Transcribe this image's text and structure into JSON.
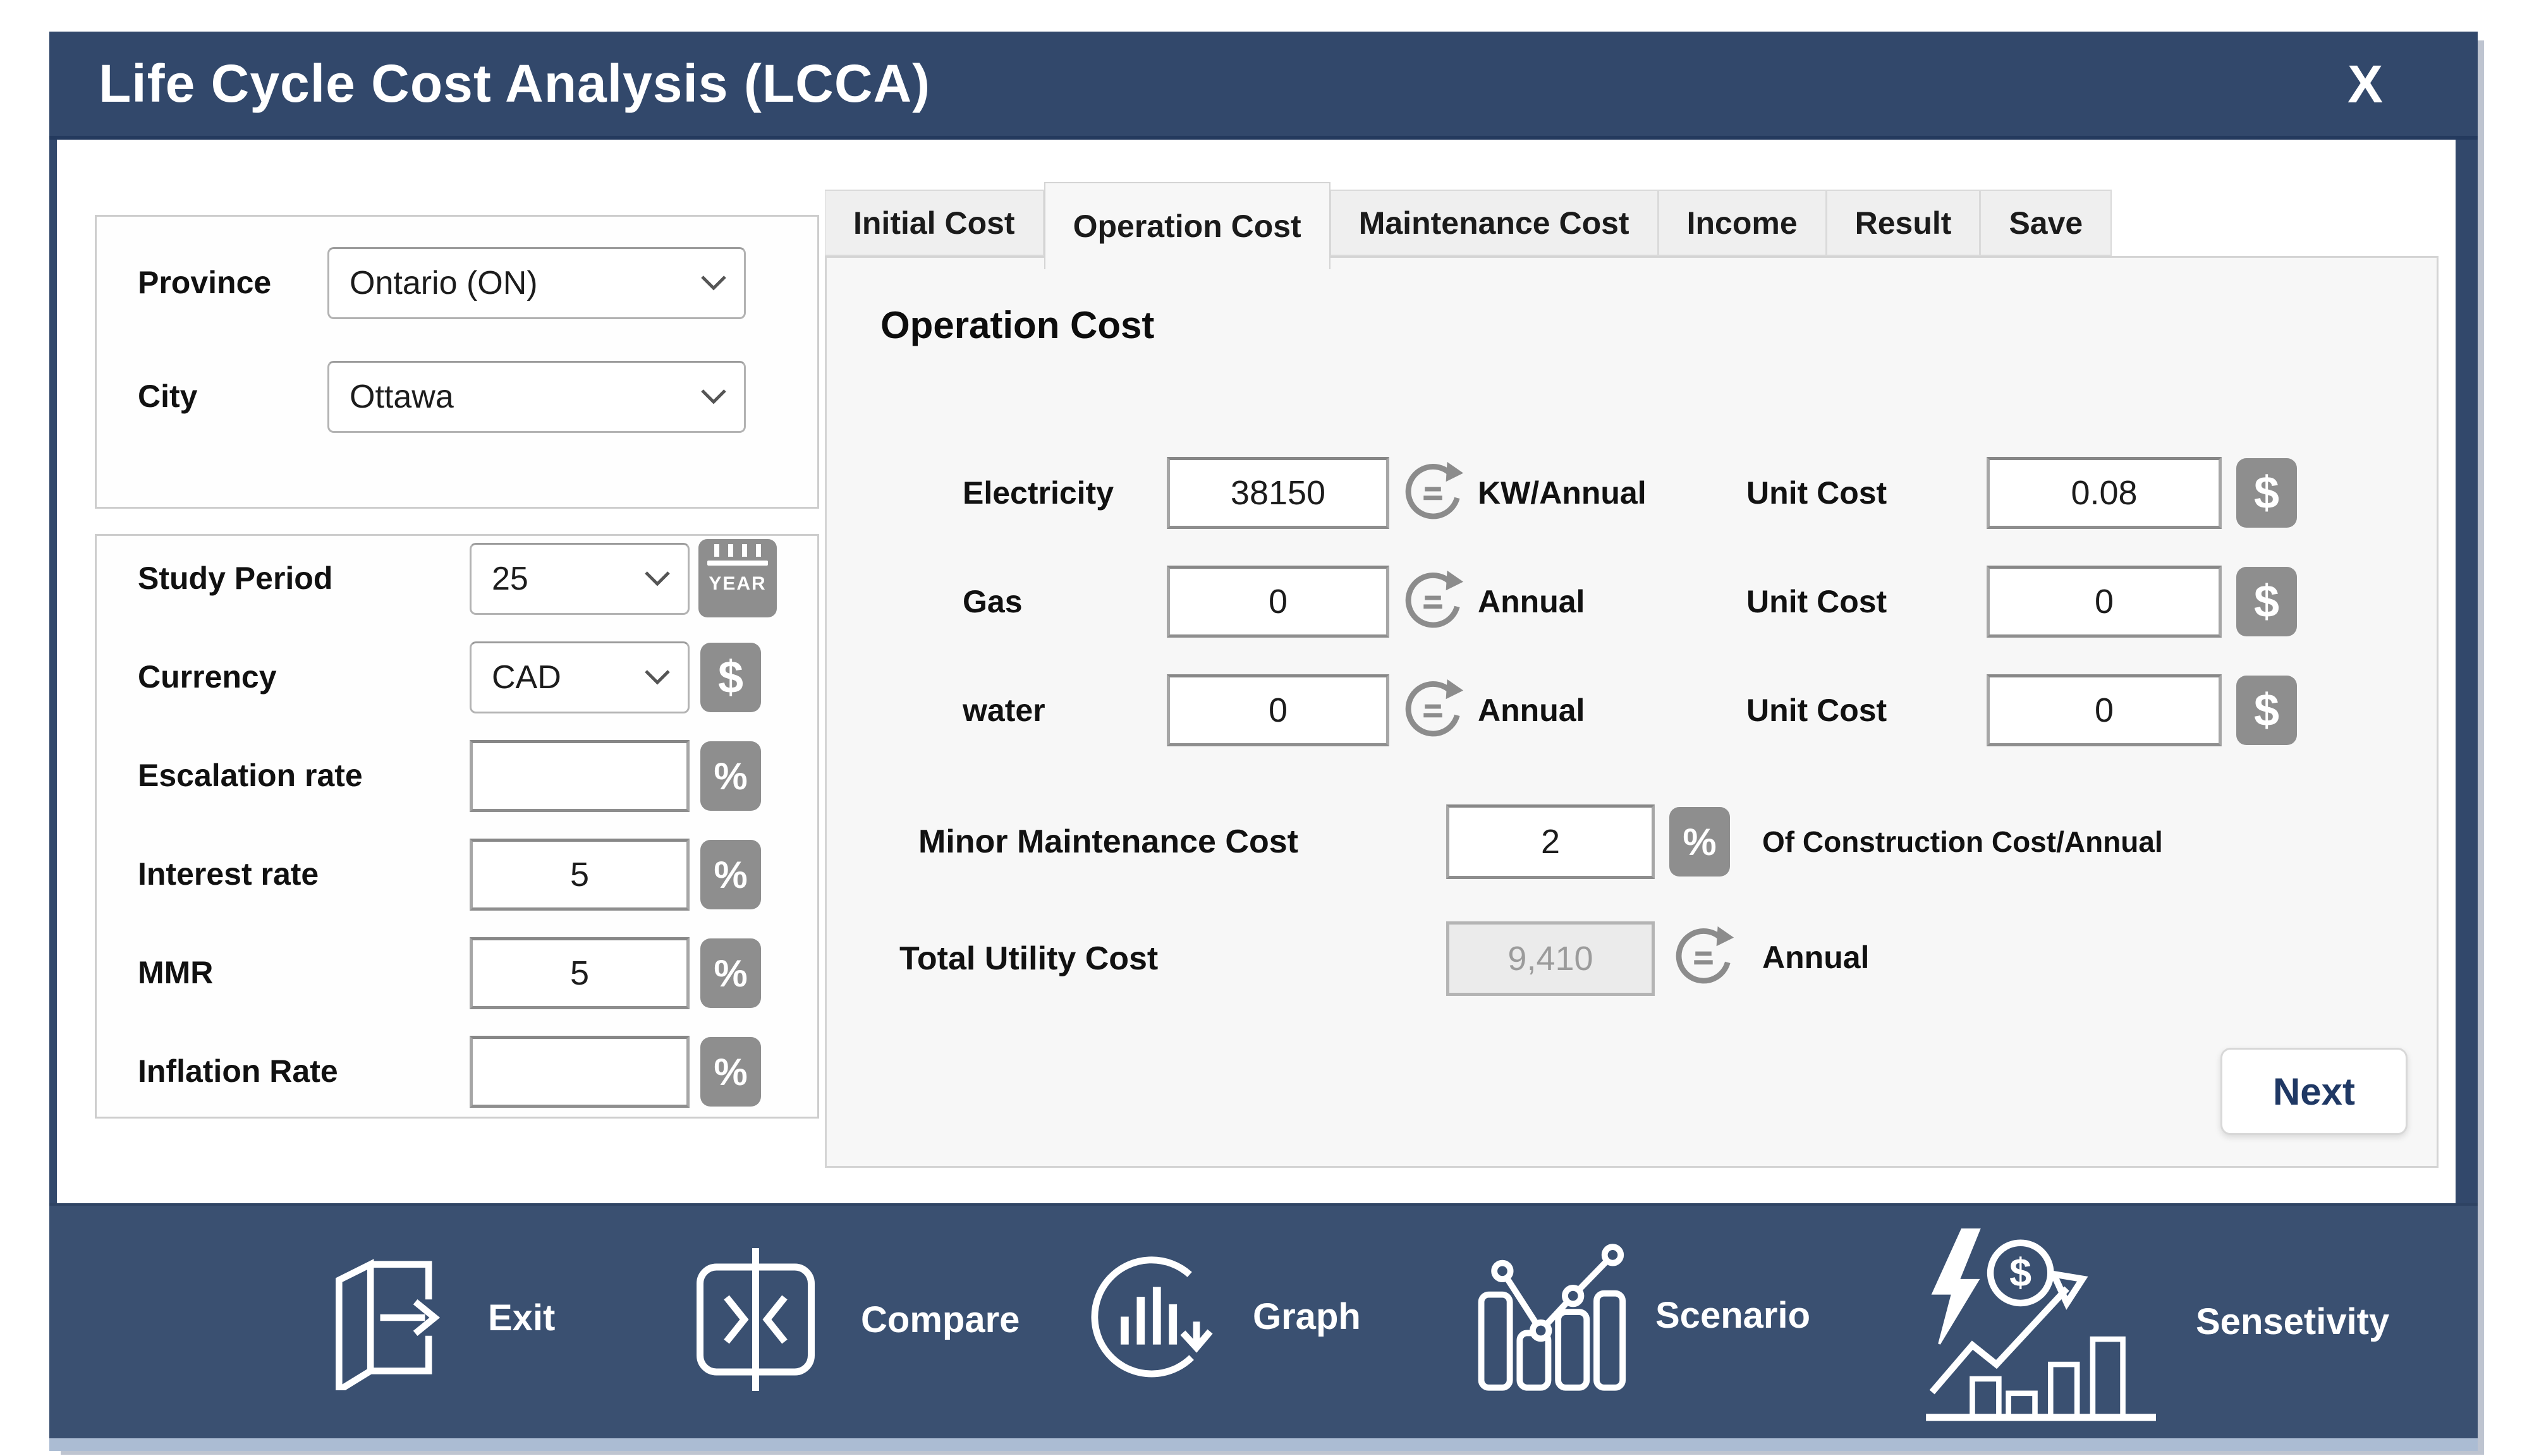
{
  "window": {
    "title": "Life Cycle Cost Analysis (LCCA)",
    "close": "X"
  },
  "colors": {
    "titlebar_navy": "#32486B",
    "footer_navy": "#3A5071",
    "footer_strip": "#ABBCD3",
    "icon_gray": "#8E8E8E",
    "next_text_navy": "#1F3864",
    "panel_border": "#CDCDCD"
  },
  "location_panel": {
    "province": {
      "label": "Province",
      "value": "Ontario (ON)"
    },
    "city": {
      "label": "City",
      "value": "Ottawa"
    }
  },
  "params_panel": {
    "rows": [
      {
        "label": "Study Period",
        "value": "25",
        "icon": "calendar-year",
        "type": "dropdown"
      },
      {
        "label": "Currency",
        "value": "CAD",
        "icon": "dollar",
        "type": "dropdown"
      },
      {
        "label": "Escalation rate",
        "value": "",
        "icon": "percent",
        "type": "input"
      },
      {
        "label": "Interest rate",
        "value": "5",
        "icon": "percent",
        "type": "input"
      },
      {
        "label": "MMR",
        "value": "5",
        "icon": "percent",
        "type": "input"
      },
      {
        "label": "Inflation Rate",
        "value": "",
        "icon": "percent",
        "type": "input"
      }
    ]
  },
  "tabs": [
    {
      "label": "Initial Cost",
      "active": false
    },
    {
      "label": "Operation Cost",
      "active": true
    },
    {
      "label": "Maintenance Cost",
      "active": false
    },
    {
      "label": "Income",
      "active": false
    },
    {
      "label": "Result",
      "active": false
    },
    {
      "label": "Save",
      "active": false
    }
  ],
  "operation_tab": {
    "heading": "Operation Cost",
    "rows": [
      {
        "label": "Electricity",
        "value": "38150",
        "unit": "KW/Annual",
        "unit_cost_label": "Unit Cost",
        "unit_cost_value": "0.08"
      },
      {
        "label": "Gas",
        "value": "0",
        "unit": "Annual",
        "unit_cost_label": "Unit Cost",
        "unit_cost_value": "0"
      },
      {
        "label": "water",
        "value": "0",
        "unit": "Annual",
        "unit_cost_label": "Unit Cost",
        "unit_cost_value": "0"
      }
    ],
    "minor_maintenance": {
      "label": "Minor Maintenance Cost",
      "value": "2",
      "suffix": "Of Construction Cost/Annual"
    },
    "total_utility": {
      "label": "Total Utility Cost",
      "value": "9,410",
      "unit": "Annual"
    },
    "next_button": "Next"
  },
  "footer": {
    "items": [
      {
        "label": "Exit"
      },
      {
        "label": "Compare"
      },
      {
        "label": "Graph"
      },
      {
        "label": "Scenario"
      },
      {
        "label": "Sensetivity"
      }
    ]
  },
  "icons": {
    "percent": "%",
    "dollar": "$",
    "year": "YEAR"
  }
}
